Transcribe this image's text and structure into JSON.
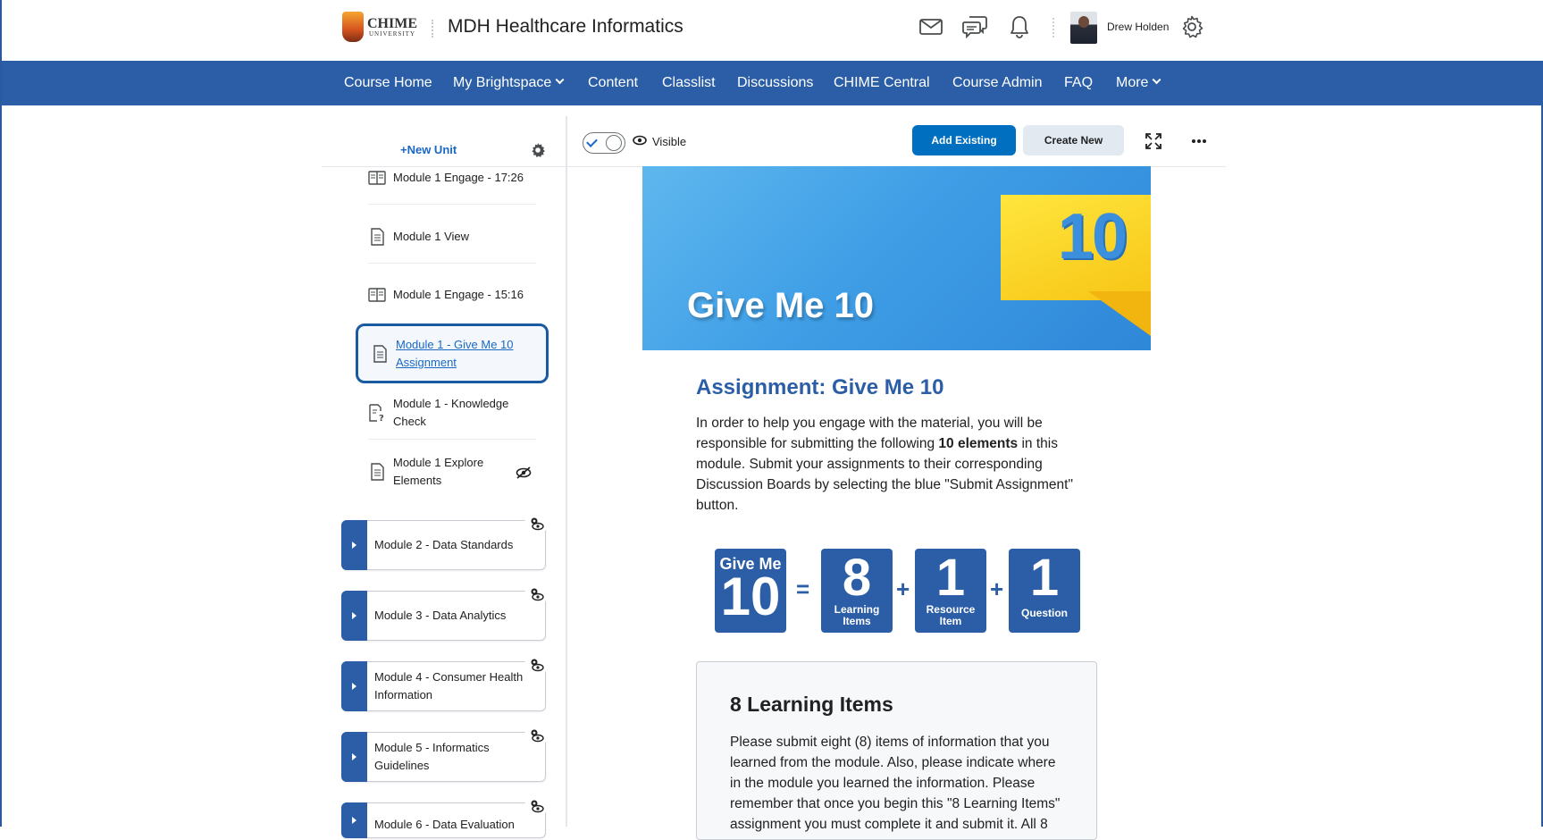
{
  "header": {
    "logo_text": "CHIME",
    "logo_subtext": "UNIVERSITY",
    "course_title": "MDH Healthcare Informatics",
    "user_name": "Drew Holden",
    "icons": [
      "mail-icon",
      "chat-icon",
      "bell-icon",
      "gear-icon"
    ]
  },
  "nav": {
    "items": [
      {
        "label": "Course Home"
      },
      {
        "label": "My Brightspace",
        "dropdown": true
      },
      {
        "label": "Content"
      },
      {
        "label": "Classlist"
      },
      {
        "label": "Discussions"
      },
      {
        "label": "CHIME Central"
      },
      {
        "label": "Course Admin"
      },
      {
        "label": "FAQ"
      },
      {
        "label": "More",
        "dropdown": true
      }
    ]
  },
  "sidebar": {
    "new_unit_label": "New Unit",
    "topics": [
      {
        "label": "Module 1 Engage - 17:26",
        "icon": "reading-icon"
      },
      {
        "label": "Module 1 View",
        "icon": "document-icon"
      },
      {
        "label": "Module 1 Engage - 15:16",
        "icon": "reading-icon"
      },
      {
        "label": "Module 1 - Give Me 10 Assignment",
        "icon": "document-icon",
        "active": true
      },
      {
        "label": "Module 1 - Knowledge Check",
        "icon": "quiz-icon"
      },
      {
        "label": "Module 1 Explore Elements",
        "icon": "document-icon",
        "hidden": true
      }
    ],
    "modules": [
      {
        "label": "Module 2 - Data Standards"
      },
      {
        "label": "Module 3 - Data Analytics"
      },
      {
        "label": "Module 4 - Consumer Health Information"
      },
      {
        "label": "Module 5 - Informatics Guidelines"
      },
      {
        "label": "Module 6 - Data Evaluation"
      }
    ]
  },
  "toolbar": {
    "visibility_label": "Visible",
    "add_existing_label": "Add Existing",
    "create_new_label": "Create New"
  },
  "content": {
    "banner_title": "Give Me 10",
    "banner_number": "10",
    "assignment_title": "Assignment: Give Me 10",
    "intro_before": "In order to help you engage with the material, you will be responsible for submitting the following ",
    "intro_bold": "10 elements",
    "intro_after": " in this module. Submit your assignments to their corresponding Discussion Boards by selecting the blue \"Submit Assignment\" button.",
    "formula": {
      "total_top": "Give Me",
      "total_num": "10",
      "equals": "=",
      "plus": "+",
      "parts": [
        {
          "num": "8",
          "label_1": "Learning",
          "label_2": "Items"
        },
        {
          "num": "1",
          "label_1": "Resource",
          "label_2": "Item"
        },
        {
          "num": "1",
          "label_1": "Question",
          "label_2": ""
        }
      ]
    },
    "card_title": "8 Learning Items",
    "card_body": "Please submit eight (8) items of information that you learned from the module. Also, please indicate where in the module you learned the information. Please remember that once you begin this \"8 Learning Items\" assignment you must complete it and submit it.  All 8"
  },
  "colors": {
    "brand_blue": "#2b5ea6",
    "primary_button": "#006fbf",
    "link_blue": "#1968c4"
  }
}
